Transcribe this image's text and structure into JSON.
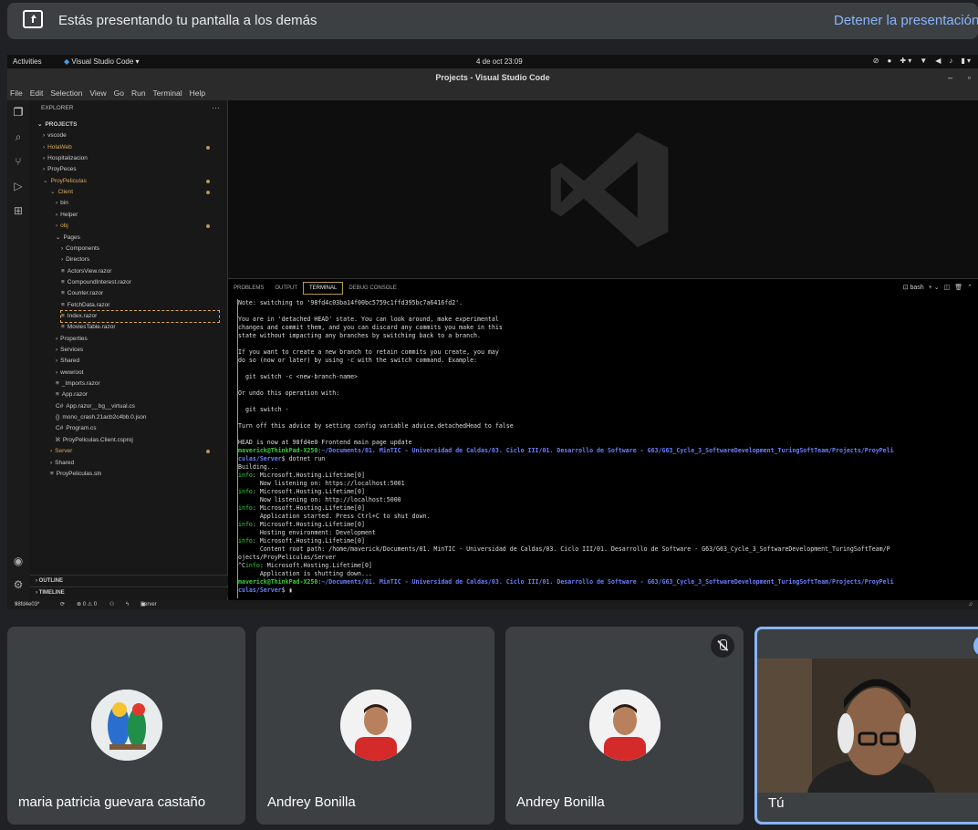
{
  "meet": {
    "presenting_text": "Estás presentando tu pantalla a los demás",
    "stop_label": "Detener la presentación"
  },
  "gnome": {
    "activities": "Activities",
    "app": "Visual Studio Code ▾",
    "clock": "4 de oct  23:09"
  },
  "vscode": {
    "title": "Projects - Visual Studio Code",
    "menu": [
      "File",
      "Edit",
      "Selection",
      "View",
      "Go",
      "Run",
      "Terminal",
      "Help"
    ],
    "explorer_title": "EXPLORER",
    "more": "···",
    "tree": [
      {
        "label": "PROJECTS",
        "indent": 0,
        "arrow": "⌄",
        "bold": true
      },
      {
        "label": "vscode",
        "indent": 1,
        "arrow": "›"
      },
      {
        "label": "HolaWeb",
        "indent": 1,
        "arrow": "›",
        "mod": true,
        "dot": true
      },
      {
        "label": "Hospitalizacion",
        "indent": 1,
        "arrow": "›"
      },
      {
        "label": "ProyPeces",
        "indent": 1,
        "arrow": "›"
      },
      {
        "label": "ProyPeliculas",
        "indent": 1,
        "arrow": "⌄",
        "mod": true,
        "dot": true
      },
      {
        "label": "Client",
        "indent": 2,
        "arrow": "⌄",
        "mod": true,
        "dot": true
      },
      {
        "label": "bin",
        "indent": 3,
        "arrow": "›"
      },
      {
        "label": "Helper",
        "indent": 3,
        "arrow": "›"
      },
      {
        "label": "obj",
        "indent": 3,
        "arrow": "›",
        "mod": true,
        "dot": true
      },
      {
        "label": "Pages",
        "indent": 3,
        "arrow": "⌄"
      },
      {
        "label": "Components",
        "indent": 4,
        "arrow": "›"
      },
      {
        "label": "Directors",
        "indent": 4,
        "arrow": "›"
      },
      {
        "label": "ActorsView.razor",
        "indent": 4,
        "arrow": "≡"
      },
      {
        "label": "CompoundInterest.razor",
        "indent": 4,
        "arrow": "≡"
      },
      {
        "label": "Counter.razor",
        "indent": 4,
        "arrow": "≡"
      },
      {
        "label": "FetchData.razor",
        "indent": 4,
        "arrow": "≡"
      },
      {
        "label": "Index.razor",
        "indent": 4,
        "arrow": "≡",
        "sel": true
      },
      {
        "label": "MoviesTable.razor",
        "indent": 4,
        "arrow": "≡"
      },
      {
        "label": "Properties",
        "indent": 3,
        "arrow": "›"
      },
      {
        "label": "Services",
        "indent": 3,
        "arrow": "›"
      },
      {
        "label": "Shared",
        "indent": 3,
        "arrow": "›"
      },
      {
        "label": "wwwroot",
        "indent": 3,
        "arrow": "›"
      },
      {
        "label": "_Imports.razor",
        "indent": 3,
        "arrow": "≡"
      },
      {
        "label": "App.razor",
        "indent": 3,
        "arrow": "≡"
      },
      {
        "label": "App.razor__bg__virtual.cs",
        "indent": 3,
        "arrow": "C#"
      },
      {
        "label": "mono_crash.21acb2c4bb.0.json",
        "indent": 3,
        "arrow": "{}"
      },
      {
        "label": "Program.cs",
        "indent": 3,
        "arrow": "C#"
      },
      {
        "label": "ProyPeliculas.Client.csproj",
        "indent": 3,
        "arrow": "ℵ"
      },
      {
        "label": "Server",
        "indent": 2,
        "arrow": "›",
        "mod": true,
        "dot": true
      },
      {
        "label": "Shared",
        "indent": 2,
        "arrow": "›"
      },
      {
        "label": "ProyPeliculas.sln",
        "indent": 2,
        "arrow": "≡"
      }
    ],
    "outline": "OUTLINE",
    "timeline": "TIMELINE",
    "panel_tabs": [
      "PROBLEMS",
      "OUTPUT",
      "TERMINAL",
      "DEBUG CONSOLE"
    ],
    "shell": "bash",
    "status": {
      "branch": "98fd4e03*",
      "sync": "⟳",
      "problems": "⊗ 0 ⚠ 0",
      "server": "Server not selected"
    },
    "terminal_lines": [
      {
        "t": "Note: switching to '98fd4c03ba14f00bc5759c1ffd395bc7a6416fd2'."
      },
      {
        "t": ""
      },
      {
        "t": "You are in 'detached HEAD' state. You can look around, make experimental"
      },
      {
        "t": "changes and commit them, and you can discard any commits you make in this"
      },
      {
        "t": "state without impacting any branches by switching back to a branch."
      },
      {
        "t": ""
      },
      {
        "t": "If you want to create a new branch to retain commits you create, you may"
      },
      {
        "t": "do so (now or later) by using -c with the switch command. Example:"
      },
      {
        "t": ""
      },
      {
        "t": "  git switch -c <new-branch-name>"
      },
      {
        "t": ""
      },
      {
        "t": "Or undo this operation with:"
      },
      {
        "t": ""
      },
      {
        "t": "  git switch -"
      },
      {
        "t": ""
      },
      {
        "t": "Turn off this advice by setting config variable advice.detachedHead to false"
      },
      {
        "t": ""
      },
      {
        "t": "HEAD is now at 98fd4e0 Frontend main page update"
      },
      {
        "p": "maverick@ThinkPad-X250",
        "path": ":~/Documents/01. MinTIC - Universidad de Caldas/03. Ciclo III/01. Desarrollo de Software - G63/G63_Cycle_3_SoftwareDevelopment_TuringSoftTeam/Projects/ProyPeli"
      },
      {
        "path": "culas/Server",
        "t": "$ dotnet run"
      },
      {
        "t": "Building..."
      },
      {
        "info": "info",
        "t": ": Microsoft.Hosting.Lifetime[0]"
      },
      {
        "t": "      Now listening on: https://localhost:5001"
      },
      {
        "info": "info",
        "t": ": Microsoft.Hosting.Lifetime[0]"
      },
      {
        "t": "      Now listening on: http://localhost:5000"
      },
      {
        "info": "info",
        "t": ": Microsoft.Hosting.Lifetime[0]"
      },
      {
        "t": "      Application started. Press Ctrl+C to shut down."
      },
      {
        "info": "info",
        "t": ": Microsoft.Hosting.Lifetime[0]"
      },
      {
        "t": "      Hosting environment: Development"
      },
      {
        "info": "info",
        "t": ": Microsoft.Hosting.Lifetime[0]"
      },
      {
        "t": "      Content root path: /home/maverick/Documents/01. MinTIC - Universidad de Caldas/03. Ciclo III/01. Desarrollo de Software - G63/G63_Cycle_3_SoftwareDevelopment_TuringSoftTeam/P"
      },
      {
        "t": "ojects/ProyPeliculas/Server"
      },
      {
        "t": "^C",
        "info": "info",
        "t2": ": Microsoft.Hosting.Lifetime[0]"
      },
      {
        "t": "      Application is shutting down..."
      },
      {
        "p": "maverick@ThinkPad-X250",
        "path": ":~/Documents/01. MinTIC - Universidad de Caldas/03. Ciclo III/01. Desarrollo de Software - G63/G63_Cycle_3_SoftwareDevelopment_TuringSoftTeam/Projects/ProyPeli"
      },
      {
        "path": "culas/Server",
        "t": "$ ▮"
      }
    ]
  },
  "participants": [
    {
      "name": "maria patricia guevara castaño",
      "avatar": "parrot-avatar"
    },
    {
      "name": "Andrey Bonilla",
      "avatar": "person-avatar"
    },
    {
      "name": "Andrey Bonilla",
      "avatar": "person-avatar",
      "muted": true
    },
    {
      "name": "Tú",
      "self": true
    }
  ]
}
